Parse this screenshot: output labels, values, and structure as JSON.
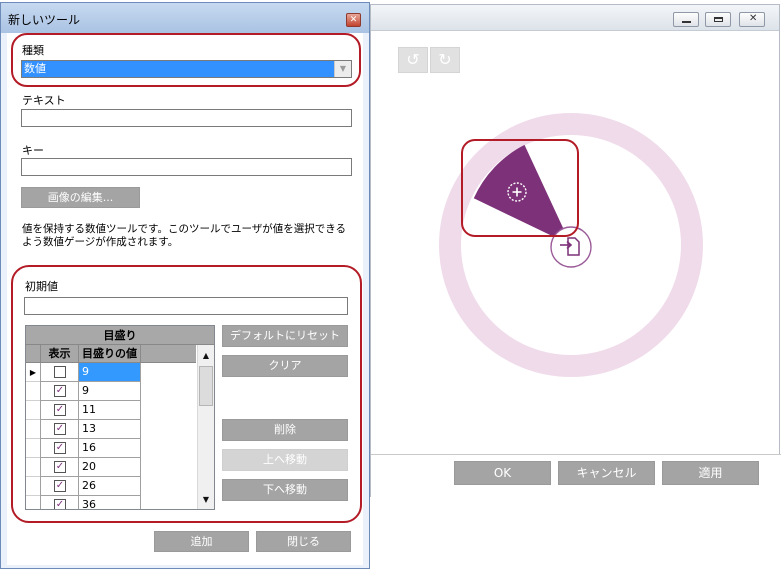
{
  "dialog": {
    "title": "新しいツール",
    "close_glyph": "✕",
    "type_label": "種類",
    "type_value": "数値",
    "text_label": "テキスト",
    "text_value": "",
    "key_label": "キー",
    "key_value": "",
    "edit_image_label": "画像の編集...",
    "description": "値を保持する数値ツールです。このツールでユーザが値を選択できるよう数値ゲージが作成されます。",
    "initial_value_label": "初期値",
    "initial_value": "",
    "grid": {
      "group_header": "目盛り",
      "col_show": "表示",
      "col_value": "目盛りの値",
      "rows": [
        {
          "checked": false,
          "value": "9",
          "selected": true
        },
        {
          "checked": true,
          "value": "9",
          "selected": false
        },
        {
          "checked": true,
          "value": "11",
          "selected": false
        },
        {
          "checked": true,
          "value": "13",
          "selected": false
        },
        {
          "checked": true,
          "value": "16",
          "selected": false
        },
        {
          "checked": true,
          "value": "20",
          "selected": false
        },
        {
          "checked": true,
          "value": "26",
          "selected": false
        },
        {
          "checked": true,
          "value": "36",
          "selected": false
        }
      ]
    },
    "buttons": {
      "reset": "デフォルトにリセット",
      "clear": "クリア",
      "delete": "削除",
      "move_up": "上へ移動",
      "move_down": "下へ移動",
      "add": "追加",
      "close": "閉じる"
    }
  },
  "background_window": {
    "footer_buttons": {
      "ok": "OK",
      "cancel": "キャンセル",
      "apply": "適用"
    },
    "icons": [
      "undo-icon",
      "redo-icon",
      "add-point-icon",
      "import-icon"
    ]
  },
  "colors": {
    "accent_purple": "#7d3179",
    "ring_pink": "#f0dbea",
    "highlight_red": "#b31b26",
    "selection_blue": "#3390ff",
    "button_grey": "#a4a4a4"
  }
}
